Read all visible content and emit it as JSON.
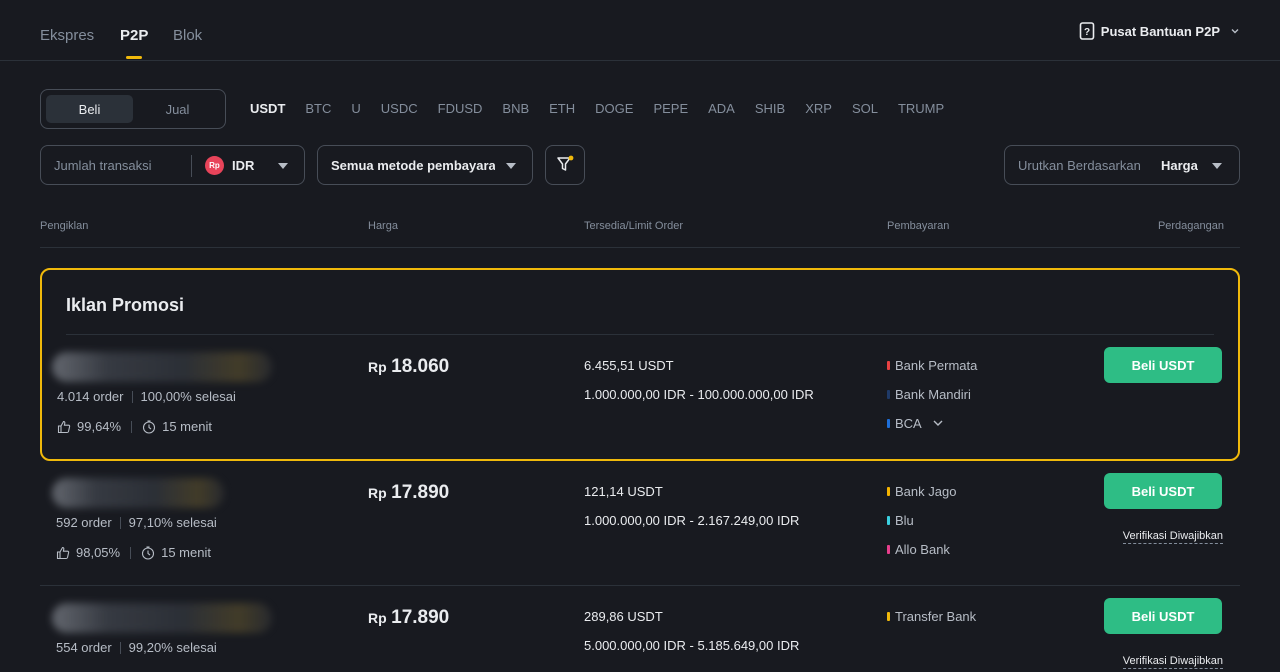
{
  "nav": {
    "tabs": [
      "Ekspres",
      "P2P",
      "Blok"
    ],
    "help_label": "Pusat Bantuan P2P"
  },
  "trade_toggle": {
    "buy": "Beli",
    "sell": "Jual"
  },
  "coins": [
    "USDT",
    "BTC",
    "U",
    "USDC",
    "FDUSD",
    "BNB",
    "ETH",
    "DOGE",
    "PEPE",
    "ADA",
    "SHIB",
    "XRP",
    "SOL",
    "TRUMP"
  ],
  "filters": {
    "amount_placeholder": "Jumlah transaksi",
    "currency_icon": "Rp",
    "currency": "IDR",
    "payment_method": "Semua metode pembayaran",
    "sort_label": "Urutkan Berdasarkan",
    "sort_value": "Harga"
  },
  "table_header": {
    "advertiser": "Pengiklan",
    "price": "Harga",
    "available": "Tersedia/Limit Order",
    "payment": "Pembayaran",
    "trade": "Perdagangan"
  },
  "promo_title": "Iklan Promosi",
  "ads": [
    {
      "orders": "4.014 order",
      "completion": "100,00% selesai",
      "rating": "99,64%",
      "time": "15 menit",
      "price_prefix": "Rp",
      "price": "18.060",
      "available": "6.455,51 USDT",
      "limit": "1.000.000,00 IDR - 100.000.000,00 IDR",
      "payments": [
        {
          "name": "Bank Permata",
          "color": "#e84142"
        },
        {
          "name": "Bank Mandiri",
          "color": "#1f3a68"
        },
        {
          "name": "BCA",
          "color": "#1e6fd9"
        }
      ],
      "button": "Beli USDT",
      "verification": ""
    },
    {
      "orders": "592 order",
      "completion": "97,10% selesai",
      "rating": "98,05%",
      "time": "15 menit",
      "price_prefix": "Rp",
      "price": "17.890",
      "available": "121,14 USDT",
      "limit": "1.000.000,00 IDR - 2.167.249,00 IDR",
      "payments": [
        {
          "name": "Bank Jago",
          "color": "#f5b400"
        },
        {
          "name": "Blu",
          "color": "#3ad0e0"
        },
        {
          "name": "Allo Bank",
          "color": "#e83e8c"
        }
      ],
      "button": "Beli USDT",
      "verification": "Verifikasi Diwajibkan"
    },
    {
      "orders": "554 order",
      "completion": "99,20% selesai",
      "rating": "",
      "time": "",
      "price_prefix": "Rp",
      "price": "17.890",
      "available": "289,86 USDT",
      "limit": "5.000.000,00 IDR - 5.185.649,00 IDR",
      "payments": [
        {
          "name": "Transfer Bank",
          "color": "#f0b90b"
        }
      ],
      "button": "Beli USDT",
      "verification": "Verifikasi Diwajibkan"
    }
  ]
}
